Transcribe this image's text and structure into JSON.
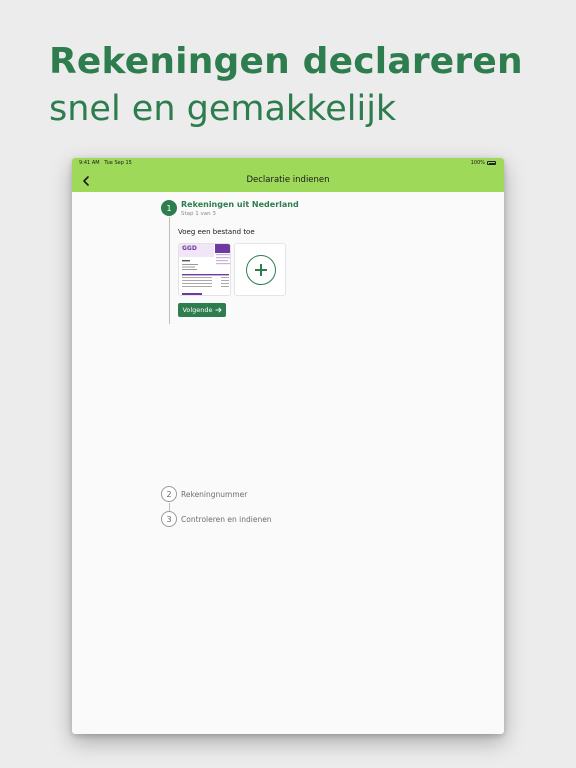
{
  "headline": {
    "line1": "Rekeningen declareren",
    "line2": "snel en gemakkelijk"
  },
  "status_bar": {
    "time": "9:41 AM",
    "date": "Tue Sep 15",
    "battery": "100%"
  },
  "nav": {
    "title": "Declaratie indienen",
    "back_icon": "chevron-left-icon"
  },
  "steps": [
    {
      "number": "1",
      "title": "Rekeningen uit Nederland",
      "subtitle": "Stap 1 van 3",
      "state": "active"
    },
    {
      "number": "2",
      "title": "Rekeningnummer",
      "state": "inactive"
    },
    {
      "number": "3",
      "title": "Controleren en indienen",
      "state": "inactive"
    }
  ],
  "upload": {
    "label": "Voeg een bestand toe",
    "thumbnail_logo": "GGD",
    "add_icon": "plus-icon"
  },
  "next_button": {
    "label": "Volgende",
    "icon": "arrow-right-icon"
  },
  "colors": {
    "brand_green": "#2e7d4f",
    "nav_green": "#9ed95a",
    "invoice_purple": "#6d3aa0"
  }
}
